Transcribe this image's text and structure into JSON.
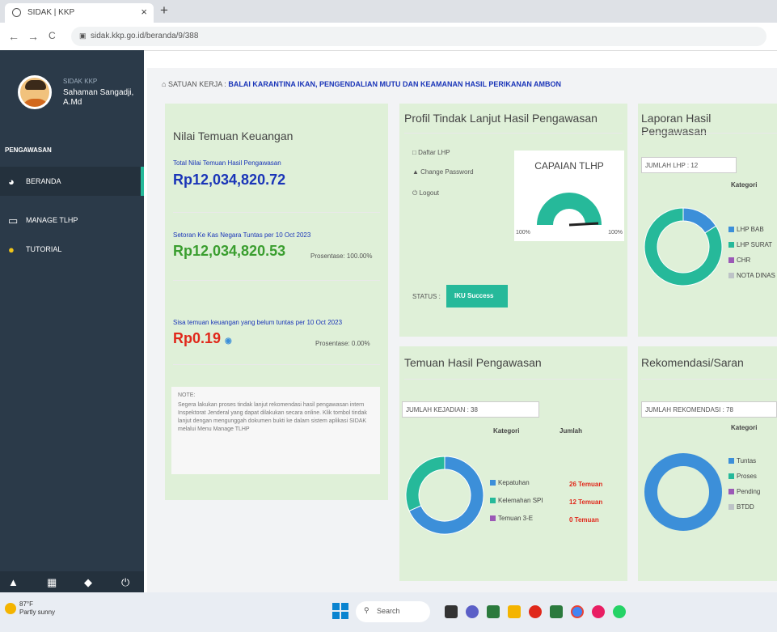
{
  "browser": {
    "tab_title": "SIDAK | KKP",
    "tab_close": "×",
    "new_tab": "+",
    "url": "sidak.kkp.go.id/beranda/9/388",
    "back": "←",
    "forward": "→",
    "reload": "C"
  },
  "sidebar": {
    "org_label": "SIDAK KKP",
    "user_name": "Sahaman Sangadji, A.Md",
    "section": "PENGAWASAN",
    "items": [
      {
        "label": "BERANDA",
        "icon": "dashboard-icon"
      },
      {
        "label": "MANAGE TLHP",
        "icon": "monitor-icon"
      },
      {
        "label": "TUTORIAL",
        "icon": "info-icon"
      }
    ],
    "footer_icons": [
      "lock-icon",
      "grid-icon",
      "tag-icon",
      "power-icon"
    ]
  },
  "header": {
    "unit_prefix": "SATUAN KERJA :",
    "unit_name": "BALAI KARANTINA IKAN, PENGENDALIAN MUTU DAN KEAMANAN HASIL PERIKANAN AMBON"
  },
  "nilai": {
    "title": "Nilai Temuan Keuangan",
    "total_label": "Total Nilai Temuan Hasil Pengawasan",
    "total_value": "Rp12,034,820.72",
    "setoran_label": "Setoran Ke Kas Negara Tuntas per 10 Oct 2023",
    "setoran_value": "Rp12,034,820.53",
    "setoran_pct": "Prosentase: 100.00%",
    "sisa_label": "Sisa temuan keuangan yang belum tuntas per 10 Oct 2023",
    "sisa_value": "Rp0.19",
    "sisa_pct": "Prosentase: 0.00%",
    "note_title": "NOTE:",
    "note_text": "Segera lakukan proses tindak lanjut rekomendasi hasil pengawasan intern Inspektorat Jenderal yang dapat dilakukan secara online. Klik tombol tindak lanjut dengan mengunggah dokumen bukti ke dalam sistem aplikasi SIDAK melalui Menu Manage TLHP"
  },
  "profil": {
    "title": "Profil Tindak Lanjut Hasil Pengawasan",
    "links": [
      "Daftar LHP",
      "Change Password",
      "Logout"
    ],
    "gauge_title": "CAPAIAN TLHP",
    "gauge_min": "100%",
    "gauge_max": "100%",
    "status_label": "STATUS :",
    "status_value": "IKU Success"
  },
  "laporan": {
    "title": "Laporan Hasil Pengawasan",
    "count_label": "JUMLAH LHP : 12",
    "kategori": "Kategori",
    "legend": [
      {
        "label": "LHP BAB",
        "color": "#3c8fd9"
      },
      {
        "label": "LHP SURAT",
        "color": "#26b99a"
      },
      {
        "label": "CHR",
        "color": "#9b59b6"
      },
      {
        "label": "NOTA DINAS",
        "color": "#bdc3c7"
      }
    ],
    "donut_share": [
      0.16,
      0.84,
      0,
      0
    ]
  },
  "temuan": {
    "title": "Temuan Hasil Pengawasan",
    "count_label": "JUMLAH KEJADIAN : 38",
    "kategori": "Kategori",
    "jumlah": "Jumlah",
    "legend": [
      {
        "label": "Kepatuhan",
        "color": "#3c8fd9",
        "value": "26 Temuan"
      },
      {
        "label": "Kelemahan SPI",
        "color": "#26b99a",
        "value": "12 Temuan"
      },
      {
        "label": "Temuan 3-E",
        "color": "#9b59b6",
        "value": "0 Temuan"
      }
    ],
    "donut_share": [
      0.684,
      0.316,
      0
    ]
  },
  "rekomendasi": {
    "title": "Rekomendasi/Saran",
    "count_label": "JUMLAH REKOMENDASI : 78",
    "kategori": "Kategori",
    "legend": [
      {
        "label": "Tuntas",
        "color": "#3c8fd9"
      },
      {
        "label": "Proses",
        "color": "#26b99a"
      },
      {
        "label": "Pending",
        "color": "#9b59b6"
      },
      {
        "label": "BTDD",
        "color": "#bdc3c7"
      }
    ],
    "donut_share": [
      1,
      0,
      0,
      0
    ]
  },
  "taskbar": {
    "weather_temp": "87°F",
    "weather_desc": "Partly sunny",
    "search": "Search"
  }
}
